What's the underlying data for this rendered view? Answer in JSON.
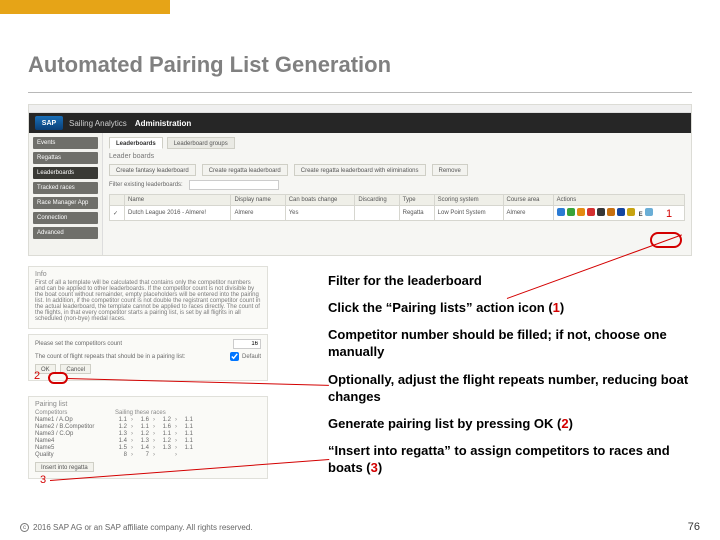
{
  "slide": {
    "title": "Automated Pairing List Generation",
    "page_number": "76",
    "copyright": "2016 SAP AG or an SAP affiliate company. All rights reserved."
  },
  "screenshot": {
    "logo_text": "SAP",
    "app_name": "Sailing Analytics",
    "section": "Administration",
    "sidebar": {
      "items": [
        "Events",
        "Regattas",
        "Leaderboards",
        "Tracked races",
        "Race Manager App",
        "Connection",
        "Advanced"
      ],
      "active_index": 2
    },
    "tabs": {
      "items": [
        "Leaderboards",
        "Leaderboard groups"
      ],
      "active_index": 0
    },
    "subpanel_title": "Leader boards",
    "toolbar_buttons": [
      "Create fantasy leaderboard",
      "Create regatta leaderboard",
      "Create regatta leaderboard with eliminations",
      "Remove"
    ],
    "filter": {
      "label": "Filter existing leaderboards:",
      "value": ""
    },
    "table": {
      "headers": [
        "",
        "Name",
        "Display name",
        "Can boats change",
        "Discarding",
        "Type",
        "Scoring system",
        "Course area",
        "Actions"
      ],
      "row": {
        "check": "✓",
        "name": "Dutch League 2016 - Almere!",
        "display": "Almere",
        "change": "Yes",
        "discarding": "",
        "type": "Regatta",
        "scoring": "Low Point System",
        "course": "Almere"
      },
      "action_colors": [
        "#2b7bd4",
        "#39a339",
        "#e38a12",
        "#d43030",
        "#373737",
        "#c77010",
        "#1446a0",
        "#c7a310"
      ],
      "action_e_label": "E"
    }
  },
  "info_panel": {
    "title": "Info",
    "body": "First of all a template will be calculated that contains only the competitor numbers and can be applied to other leaderboards. If the competitor count is not divisible by the boat count without remainder, empty placeholders will be entered into the pairing list. In addition, if the competitor count is not double the registrant competitor count in the actual leaderboard, the template cannot be applied to races directly. The count of the flights, in that every competitor starts a pairing list, is set by all flights in all scheduled (non-bye) medal races."
  },
  "count_panel": {
    "label_count": "Please set the competitors count",
    "count_value": "16",
    "label_repeats": "The count of flight repeats that should be in a pairing list:",
    "repeats_checked": true,
    "repeats_label": "Default",
    "ok_label": "OK",
    "cancel_label": "Cancel"
  },
  "pairing_panel": {
    "title": "Pairing list",
    "col_competitors": "Competitors",
    "col_sailing": "Sailing these races",
    "rows": [
      {
        "label": "Name1 / A.Op",
        "cells": [
          "1.1",
          "1.6",
          "1.2",
          "1.1"
        ]
      },
      {
        "label": "Name2 / B.Competitor",
        "cells": [
          "1.2",
          "1.1",
          "1.6",
          "1.1"
        ]
      },
      {
        "label": "Name3 / C.Op",
        "cells": [
          "1.3",
          "1.2",
          "1.1",
          "1.1"
        ]
      },
      {
        "label": "Name4",
        "cells": [
          "1.4",
          "1.3",
          "1.2",
          "1.1"
        ]
      },
      {
        "label": "Name5",
        "cells": [
          "1.5",
          "1.4",
          "1.3",
          "1.1"
        ]
      },
      {
        "label": "Quality",
        "cells": [
          "8",
          "7",
          "",
          ""
        ]
      }
    ],
    "insert_label": "Insert into regatta"
  },
  "instructions": {
    "p1_a": "Filter for the leaderboard",
    "p2_a": "Click the “Pairing lists” action icon (",
    "p2_b": ")",
    "p3": "Competitor number should be filled; if not, choose one manually",
    "p4": "Optionally, adjust the flight repeats number, reducing boat changes",
    "p5_a": "Generate pairing list by pressing OK (",
    "p5_b": ")",
    "p6_a": "“Insert into regatta” to assign competitors to races and boats (",
    "p6_b": ")"
  },
  "annotations": {
    "n1": "1",
    "n2": "2",
    "n3": "3"
  }
}
